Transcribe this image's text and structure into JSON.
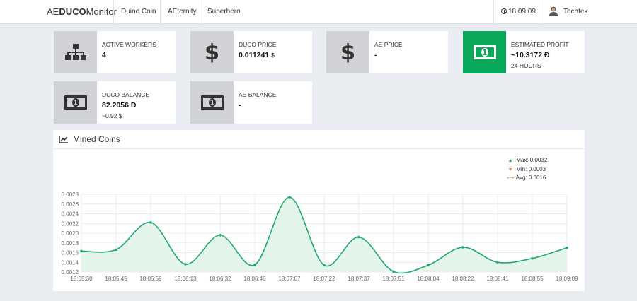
{
  "navbar": {
    "brand_prefix": "AE",
    "brand_bold": "DUCO",
    "brand_suffix": "Monitor",
    "links": [
      "Duino Coin",
      "AEternity",
      "Superhero"
    ],
    "clock": "18:09:09",
    "user": "Techtek"
  },
  "cards": {
    "active_workers": {
      "label": "ACTIVE WORKERS",
      "value": "4",
      "icon": "sitemap-icon"
    },
    "duco_price": {
      "label": "DUCO PRICE",
      "value": "0.011241",
      "unit": "$",
      "icon": "dollar-icon"
    },
    "ae_price": {
      "label": "AE PRICE",
      "value": "-",
      "icon": "dollar-icon"
    },
    "estimated_profit": {
      "label": "ESTIMATED PROFIT",
      "value": "~10.3172",
      "unit": "Ɖ",
      "sub": "24 HOURS",
      "icon": "money-icon",
      "accent": "#0aa95b"
    },
    "duco_balance": {
      "label": "DUCO BALANCE",
      "value": "82.2056",
      "unit": "Ɖ",
      "sub": "~0.92 $",
      "icon": "money-icon"
    },
    "ae_balance": {
      "label": "AE BALANCE",
      "value": "-",
      "icon": "money-icon"
    }
  },
  "chart_panel": {
    "title": "Mined Coins",
    "legend": {
      "max": "Max: 0.0032",
      "min": "Min: 0.0003",
      "avg": "Avg: 0.0016"
    }
  },
  "chart_data": {
    "type": "area",
    "title": "Mined Coins",
    "color": "#21a96b",
    "fill": "#e3f4ea",
    "ylim": [
      0.0012,
      0.0028
    ],
    "yticks": [
      "0.0012",
      "0.0014",
      "0.0016",
      "0.0018",
      "0.0020",
      "0.0022",
      "0.0024",
      "0.0026",
      "0.0028"
    ],
    "x": [
      "18:05:30",
      "18:05:45",
      "18:05:59",
      "18:06:13",
      "18:06:32",
      "18:06:46",
      "18:07:07",
      "18:07:22",
      "18:07:37",
      "18:07:51",
      "18:08:04",
      "18:08:22",
      "18:08:41",
      "18:08:55",
      "18:09:09"
    ],
    "values": [
      0.00163,
      0.00166,
      0.00222,
      0.00136,
      0.00196,
      0.00135,
      0.00274,
      0.00134,
      0.00192,
      0.00121,
      0.00134,
      0.00171,
      0.0014,
      0.00148,
      0.0017
    ],
    "grid": true,
    "legend_position": "top-right"
  }
}
